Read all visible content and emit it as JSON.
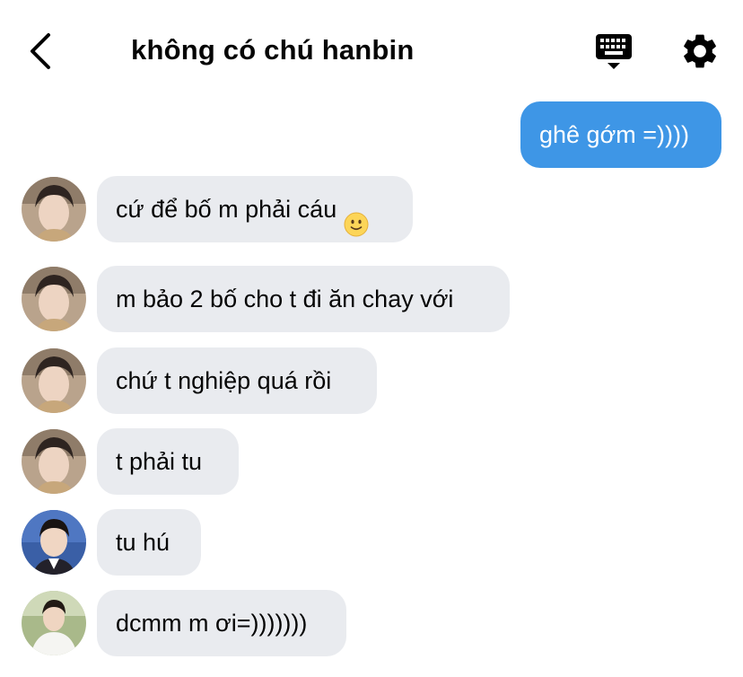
{
  "header": {
    "title": "không có chú hanbin",
    "back_icon": "chevron-left-icon",
    "keyboard_icon": "keyboard-icon",
    "settings_icon": "gear-icon"
  },
  "colors": {
    "outgoing_bubble": "#3e96e6",
    "incoming_bubble": "#e9ebef",
    "text": "#050505"
  },
  "messages": [
    {
      "direction": "outgoing",
      "text": "ghê gớm =))))"
    },
    {
      "direction": "incoming",
      "avatar": "person-a",
      "text": "cứ để bố m phải cáu",
      "emoji": "slightly-smiling-face"
    },
    {
      "direction": "incoming",
      "avatar": "person-a",
      "text": "m bảo 2 bố cho t đi ăn chay với"
    },
    {
      "direction": "incoming",
      "avatar": "person-a",
      "text": "chứ t nghiệp quá rồi"
    },
    {
      "direction": "incoming",
      "avatar": "person-a",
      "text": "t phải tu"
    },
    {
      "direction": "incoming",
      "avatar": "person-b",
      "text": "tu hú"
    },
    {
      "direction": "incoming",
      "avatar": "person-c",
      "text": "dcmm m ơi=)))))))"
    }
  ]
}
